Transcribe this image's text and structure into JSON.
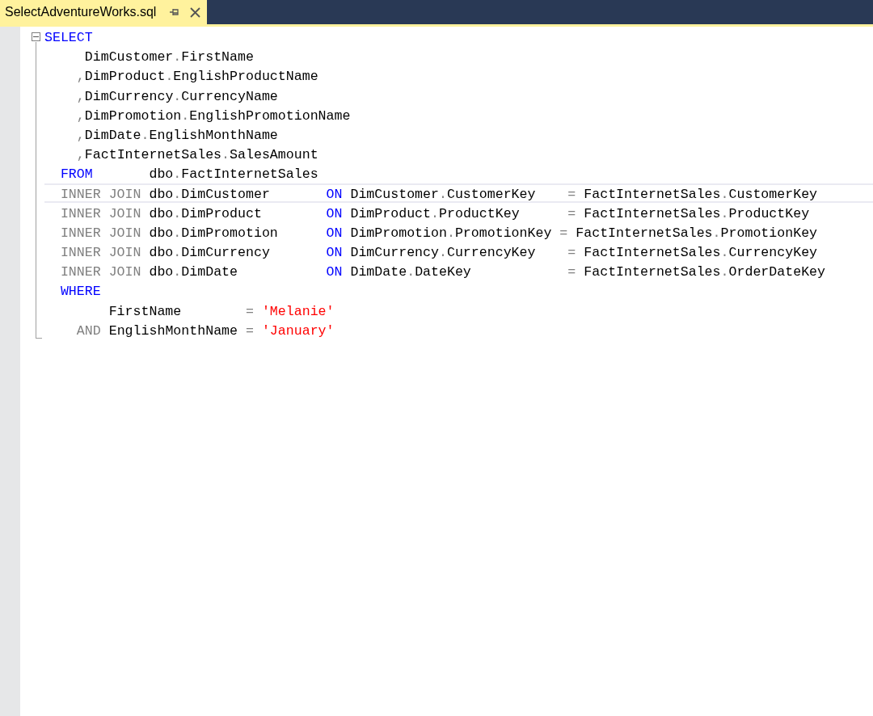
{
  "tab": {
    "title": "SelectAdventureWorks.sql",
    "selected": true
  },
  "fold_region": {
    "expanded": true
  },
  "lines": [
    {
      "current": false,
      "tokens": [
        {
          "kind": "keyword",
          "text": "SELECT"
        }
      ]
    },
    {
      "current": false,
      "tokens": [
        {
          "kind": "ident",
          "text": "     DimCustomer"
        },
        {
          "kind": "punct",
          "text": "."
        },
        {
          "kind": "ident",
          "text": "FirstName"
        }
      ]
    },
    {
      "current": false,
      "tokens": [
        {
          "kind": "punct",
          "text": "    ,"
        },
        {
          "kind": "ident",
          "text": "DimProduct"
        },
        {
          "kind": "punct",
          "text": "."
        },
        {
          "kind": "ident",
          "text": "EnglishProductName"
        }
      ]
    },
    {
      "current": false,
      "tokens": [
        {
          "kind": "punct",
          "text": "    ,"
        },
        {
          "kind": "ident",
          "text": "DimCurrency"
        },
        {
          "kind": "punct",
          "text": "."
        },
        {
          "kind": "ident",
          "text": "CurrencyName"
        }
      ]
    },
    {
      "current": false,
      "tokens": [
        {
          "kind": "punct",
          "text": "    ,"
        },
        {
          "kind": "ident",
          "text": "DimPromotion"
        },
        {
          "kind": "punct",
          "text": "."
        },
        {
          "kind": "ident",
          "text": "EnglishPromotionName"
        }
      ]
    },
    {
      "current": false,
      "tokens": [
        {
          "kind": "punct",
          "text": "    ,"
        },
        {
          "kind": "ident",
          "text": "DimDate"
        },
        {
          "kind": "punct",
          "text": "."
        },
        {
          "kind": "ident",
          "text": "EnglishMonthName"
        }
      ]
    },
    {
      "current": false,
      "tokens": [
        {
          "kind": "punct",
          "text": "    ,"
        },
        {
          "kind": "ident",
          "text": "FactInternetSales"
        },
        {
          "kind": "punct",
          "text": "."
        },
        {
          "kind": "ident",
          "text": "SalesAmount"
        }
      ]
    },
    {
      "current": false,
      "tokens": [
        {
          "kind": "keyword",
          "text": "  FROM"
        },
        {
          "kind": "ident",
          "text": "       dbo"
        },
        {
          "kind": "punct",
          "text": "."
        },
        {
          "kind": "ident",
          "text": "FactInternetSales"
        }
      ]
    },
    {
      "current": true,
      "tokens": [
        {
          "kind": "operator",
          "text": "  INNER JOIN"
        },
        {
          "kind": "ident",
          "text": " dbo"
        },
        {
          "kind": "punct",
          "text": "."
        },
        {
          "kind": "ident",
          "text": "DimCustomer"
        },
        {
          "kind": "keyword",
          "text": "       ON"
        },
        {
          "kind": "ident",
          "text": " DimCustomer"
        },
        {
          "kind": "punct",
          "text": "."
        },
        {
          "kind": "ident",
          "text": "CustomerKey"
        },
        {
          "kind": "punct",
          "text": "    ="
        },
        {
          "kind": "ident",
          "text": " FactInternetSales"
        },
        {
          "kind": "punct",
          "text": "."
        },
        {
          "kind": "ident",
          "text": "CustomerKey"
        }
      ]
    },
    {
      "current": false,
      "tokens": [
        {
          "kind": "operator",
          "text": "  INNER JOIN"
        },
        {
          "kind": "ident",
          "text": " dbo"
        },
        {
          "kind": "punct",
          "text": "."
        },
        {
          "kind": "ident",
          "text": "DimProduct"
        },
        {
          "kind": "keyword",
          "text": "        ON"
        },
        {
          "kind": "ident",
          "text": " DimProduct"
        },
        {
          "kind": "punct",
          "text": "."
        },
        {
          "kind": "ident",
          "text": "ProductKey"
        },
        {
          "kind": "punct",
          "text": "      ="
        },
        {
          "kind": "ident",
          "text": " FactInternetSales"
        },
        {
          "kind": "punct",
          "text": "."
        },
        {
          "kind": "ident",
          "text": "ProductKey"
        }
      ]
    },
    {
      "current": false,
      "tokens": [
        {
          "kind": "operator",
          "text": "  INNER JOIN"
        },
        {
          "kind": "ident",
          "text": " dbo"
        },
        {
          "kind": "punct",
          "text": "."
        },
        {
          "kind": "ident",
          "text": "DimPromotion"
        },
        {
          "kind": "keyword",
          "text": "      ON"
        },
        {
          "kind": "ident",
          "text": " DimPromotion"
        },
        {
          "kind": "punct",
          "text": "."
        },
        {
          "kind": "ident",
          "text": "PromotionKey"
        },
        {
          "kind": "punct",
          "text": " ="
        },
        {
          "kind": "ident",
          "text": " FactInternetSales"
        },
        {
          "kind": "punct",
          "text": "."
        },
        {
          "kind": "ident",
          "text": "PromotionKey"
        }
      ]
    },
    {
      "current": false,
      "tokens": [
        {
          "kind": "operator",
          "text": "  INNER JOIN"
        },
        {
          "kind": "ident",
          "text": " dbo"
        },
        {
          "kind": "punct",
          "text": "."
        },
        {
          "kind": "ident",
          "text": "DimCurrency"
        },
        {
          "kind": "keyword",
          "text": "       ON"
        },
        {
          "kind": "ident",
          "text": " DimCurrency"
        },
        {
          "kind": "punct",
          "text": "."
        },
        {
          "kind": "ident",
          "text": "CurrencyKey"
        },
        {
          "kind": "punct",
          "text": "    ="
        },
        {
          "kind": "ident",
          "text": " FactInternetSales"
        },
        {
          "kind": "punct",
          "text": "."
        },
        {
          "kind": "ident",
          "text": "CurrencyKey"
        }
      ]
    },
    {
      "current": false,
      "tokens": [
        {
          "kind": "operator",
          "text": "  INNER JOIN"
        },
        {
          "kind": "ident",
          "text": " dbo"
        },
        {
          "kind": "punct",
          "text": "."
        },
        {
          "kind": "ident",
          "text": "DimDate"
        },
        {
          "kind": "keyword",
          "text": "           ON"
        },
        {
          "kind": "ident",
          "text": " DimDate"
        },
        {
          "kind": "punct",
          "text": "."
        },
        {
          "kind": "ident",
          "text": "DateKey"
        },
        {
          "kind": "punct",
          "text": "            ="
        },
        {
          "kind": "ident",
          "text": " FactInternetSales"
        },
        {
          "kind": "punct",
          "text": "."
        },
        {
          "kind": "ident",
          "text": "OrderDateKey"
        }
      ]
    },
    {
      "current": false,
      "tokens": [
        {
          "kind": "keyword",
          "text": "  WHERE"
        }
      ]
    },
    {
      "current": false,
      "tokens": [
        {
          "kind": "ident",
          "text": "        FirstName"
        },
        {
          "kind": "punct",
          "text": "        ="
        },
        {
          "kind": "string",
          "text": " 'Melanie'"
        }
      ]
    },
    {
      "current": false,
      "tokens": [
        {
          "kind": "operator",
          "text": "    AND"
        },
        {
          "kind": "ident",
          "text": " EnglishMonthName"
        },
        {
          "kind": "punct",
          "text": " ="
        },
        {
          "kind": "string",
          "text": " 'January'"
        }
      ]
    }
  ]
}
